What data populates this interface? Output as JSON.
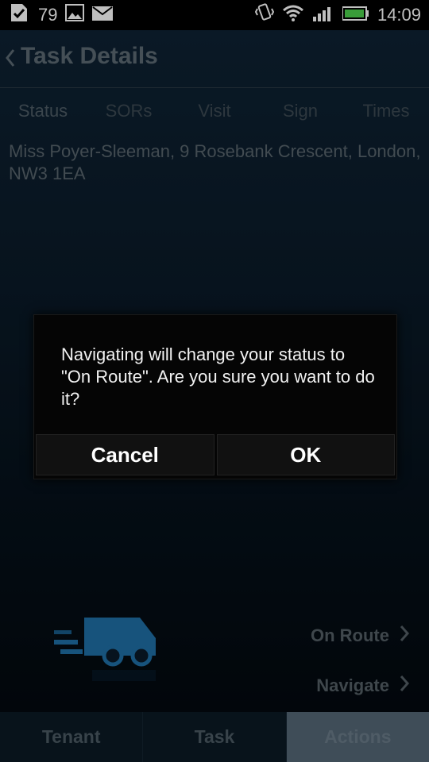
{
  "status_bar": {
    "notification_count": "79",
    "time": "14:09",
    "icons": [
      "check-icon",
      "image-icon",
      "mail-icon",
      "vibrate-icon",
      "wifi-icon",
      "signal-icon",
      "battery-icon"
    ]
  },
  "header": {
    "title": "Task Details",
    "back_icon": "chevron-left-icon"
  },
  "tabs": [
    "Status",
    "SORs",
    "Visit",
    "Sign",
    "Times"
  ],
  "address": "Miss Poyer-Sleeman, 9 Rosebank Crescent, London, NW3 1EA",
  "actions": {
    "on_route_label": "On Route",
    "navigate_label": "Navigate",
    "icon": "truck-icon"
  },
  "bottom_tabs": {
    "tenant": "Tenant",
    "task": "Task",
    "actions": "Actions",
    "selected": "Actions"
  },
  "dialog": {
    "message": "Navigating will change your status to \"On Route\". Are you sure you want to do it?",
    "cancel_label": "Cancel",
    "ok_label": "OK"
  },
  "colors": {
    "truck": "#1f6fa6",
    "selected_tab": "#556776"
  }
}
